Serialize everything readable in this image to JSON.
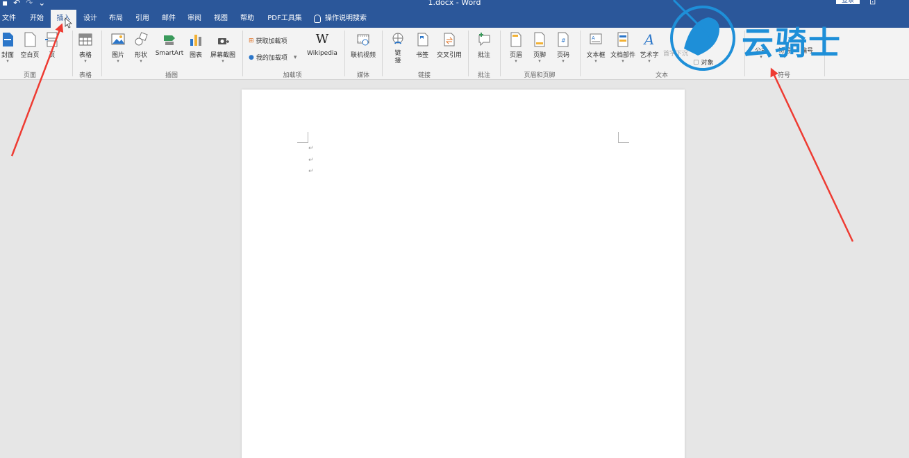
{
  "window": {
    "title": "1.docx - Word",
    "signin_label": "登录",
    "qat_icons": [
      "save-icon",
      "undo-icon",
      "redo-icon",
      "customize-icon"
    ]
  },
  "tabs": [
    {
      "label": "文件"
    },
    {
      "label": "开始"
    },
    {
      "label": "插入"
    },
    {
      "label": "设计"
    },
    {
      "label": "布局"
    },
    {
      "label": "引用"
    },
    {
      "label": "邮件"
    },
    {
      "label": "审阅"
    },
    {
      "label": "视图"
    },
    {
      "label": "帮助"
    },
    {
      "label": "PDF工具集"
    },
    {
      "label": "操作说明搜索"
    }
  ],
  "ribbon": {
    "pages": {
      "cover": "封面",
      "blank": "空白页",
      "break": "页",
      "label": "页面"
    },
    "tables": {
      "table": "表格",
      "label": "表格"
    },
    "illustrations": {
      "picture": "图片",
      "shapes": "形状",
      "smartart": "SmartArt",
      "chart": "图表",
      "screenshot": "屏幕截图",
      "label": "插图"
    },
    "addins": {
      "get": "获取加载项",
      "my": "我的加载项",
      "wikipedia": "Wikipedia",
      "wiki_glyph": "W",
      "label": "加载项"
    },
    "media": {
      "video": "联机视频",
      "label": "媒体"
    },
    "links": {
      "link_1": "链",
      "link_2": "接",
      "bookmark": "书签",
      "crossref": "交叉引用",
      "label": "链接"
    },
    "comments": {
      "comment": "批注",
      "label": "批注"
    },
    "header_footer": {
      "header": "页眉",
      "footer": "页脚",
      "page_number": "页码",
      "label": "页眉和页脚"
    },
    "text": {
      "textbox": "文本框",
      "quickparts": "文档部件",
      "wordart": "艺术字",
      "wordart_glyph": "A",
      "dropcap": "首字下沉",
      "object": "对象",
      "label": "文本"
    },
    "symbols": {
      "equation": "公式",
      "symbol": "符号",
      "number": "编号",
      "label": "符号"
    }
  },
  "document": {
    "paragraph_marks": [
      "↵",
      "↵",
      "↵"
    ]
  },
  "watermark": {
    "text": "云骑士"
  },
  "colors": {
    "accent": "#2b579a",
    "arrow": "#ee3b32",
    "watermark": "#1e8fd8"
  }
}
